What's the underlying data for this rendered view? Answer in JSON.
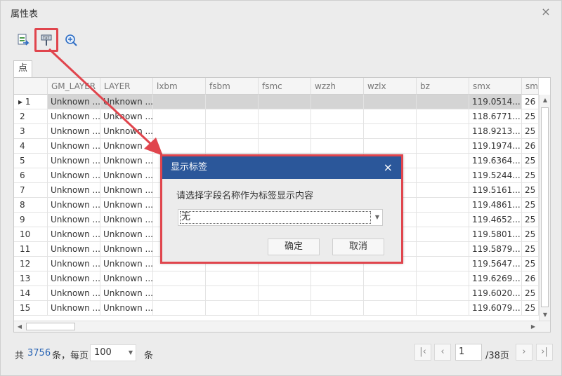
{
  "window": {
    "title": "属性表",
    "close": "×"
  },
  "tab": {
    "label": "点"
  },
  "columns": [
    "",
    "GM_LAYER",
    "LAYER",
    "lxbm",
    "fsbm",
    "fsmc",
    "wzzh",
    "wzlx",
    "bz",
    "smx",
    "smy"
  ],
  "rows": [
    {
      "n": "1",
      "gm": "Unknown ...",
      "layer": "Unknown ...",
      "smx": "119.0514...",
      "smy": "26"
    },
    {
      "n": "2",
      "gm": "Unknown ...",
      "layer": "Unknown ...",
      "smx": "118.6771...",
      "smy": "25"
    },
    {
      "n": "3",
      "gm": "Unknown ...",
      "layer": "Unknown ...",
      "smx": "118.9213...",
      "smy": "25"
    },
    {
      "n": "4",
      "gm": "Unknown ...",
      "layer": "Unknown ...",
      "smx": "119.1974...",
      "smy": "26"
    },
    {
      "n": "5",
      "gm": "Unknown ...",
      "layer": "Unknown ...",
      "smx": "119.6364...",
      "smy": "25"
    },
    {
      "n": "6",
      "gm": "Unknown ...",
      "layer": "Unknown ...",
      "smx": "119.5244...",
      "smy": "25"
    },
    {
      "n": "7",
      "gm": "Unknown ...",
      "layer": "Unknown ...",
      "smx": "119.5161...",
      "smy": "25"
    },
    {
      "n": "8",
      "gm": "Unknown ...",
      "layer": "Unknown ...",
      "smx": "119.4861...",
      "smy": "25"
    },
    {
      "n": "9",
      "gm": "Unknown ...",
      "layer": "Unknown ...",
      "smx": "119.4652...",
      "smy": "25"
    },
    {
      "n": "10",
      "gm": "Unknown ...",
      "layer": "Unknown ...",
      "smx": "119.5801...",
      "smy": "25"
    },
    {
      "n": "11",
      "gm": "Unknown ...",
      "layer": "Unknown ...",
      "smx": "119.5879...",
      "smy": "25"
    },
    {
      "n": "12",
      "gm": "Unknown ...",
      "layer": "Unknown ...",
      "smx": "119.5647...",
      "smy": "25"
    },
    {
      "n": "13",
      "gm": "Unknown ...",
      "layer": "Unknown ...",
      "smx": "119.6269...",
      "smy": "26"
    },
    {
      "n": "14",
      "gm": "Unknown ...",
      "layer": "Unknown ...",
      "smx": "119.6020...",
      "smy": "25"
    },
    {
      "n": "15",
      "gm": "Unknown ...",
      "layer": "Unknown ...",
      "smx": "119.6079...",
      "smy": "25"
    }
  ],
  "footer": {
    "total_prefix": "共",
    "total_count": "3756",
    "per_page_text": "条，每页",
    "page_size": "100",
    "unit": "条",
    "current_page": "1",
    "total_pages": "/38页"
  },
  "dialog": {
    "title": "显示标签",
    "close": "×",
    "prompt": "请选择字段名称作为标签显示内容",
    "selected": "无",
    "ok": "确定",
    "cancel": "取消"
  },
  "colors": {
    "accent": "#2b579a",
    "highlight": "#e0454d",
    "count": "#2864b4"
  }
}
